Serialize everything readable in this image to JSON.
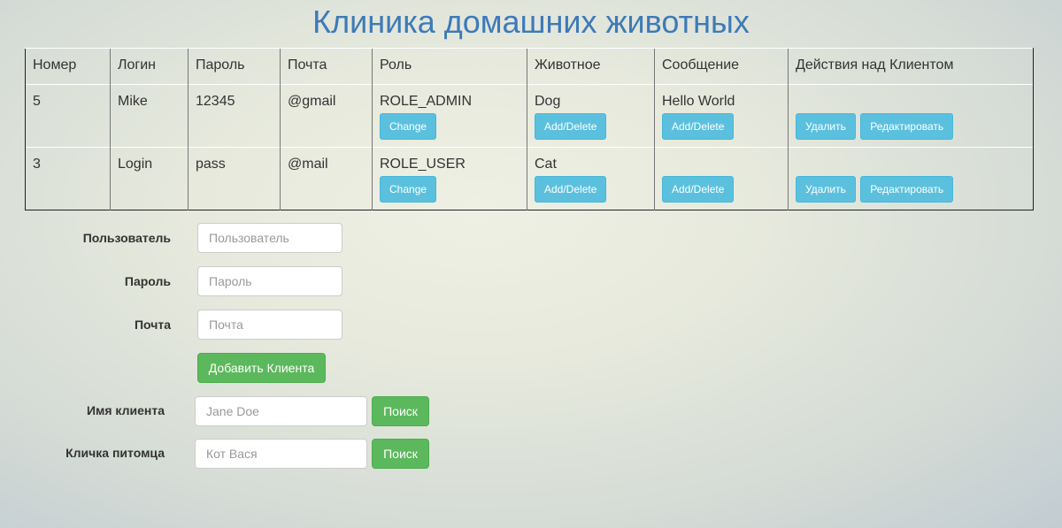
{
  "page": {
    "title": "Клиника домашних животных"
  },
  "table": {
    "headers": [
      "Номер",
      "Логин",
      "Пароль",
      "Почта",
      "Роль",
      "Животное",
      "Сообщение",
      "Действия над Клиентом"
    ],
    "rows": [
      {
        "id": "5",
        "login": "Mike",
        "password": "12345",
        "email": "@gmail",
        "role": "ROLE_ADMIN",
        "role_button": "Change",
        "animal": "Dog",
        "animal_button": "Add/Delete",
        "message": "Hello World",
        "message_button": "Add/Delete",
        "delete_button": "Удалить",
        "edit_button": "Редактировать"
      },
      {
        "id": "3",
        "login": "Login",
        "password": "pass",
        "email": "@mail",
        "role": "ROLE_USER",
        "role_button": "Change",
        "animal": "Cat",
        "animal_button": "Add/Delete",
        "message": "",
        "message_button": "Add/Delete",
        "delete_button": "Удалить",
        "edit_button": "Редактировать"
      }
    ]
  },
  "add_form": {
    "user_label": "Пользователь",
    "user_placeholder": "Пользователь",
    "password_label": "Пароль",
    "password_placeholder": "Пароль",
    "email_label": "Почта",
    "email_placeholder": "Почта",
    "submit_label": "Добавить Клиента"
  },
  "search_form": {
    "client_label": "Имя клиента",
    "client_placeholder": "Jane Doe",
    "client_button": "Поиск",
    "pet_label": "Кличка питомца",
    "pet_placeholder": "Кот Вася",
    "pet_button": "Поиск"
  },
  "colors": {
    "title": "#3d7ab8",
    "info_button": "#5bc0de",
    "success_button": "#5cb85c"
  }
}
